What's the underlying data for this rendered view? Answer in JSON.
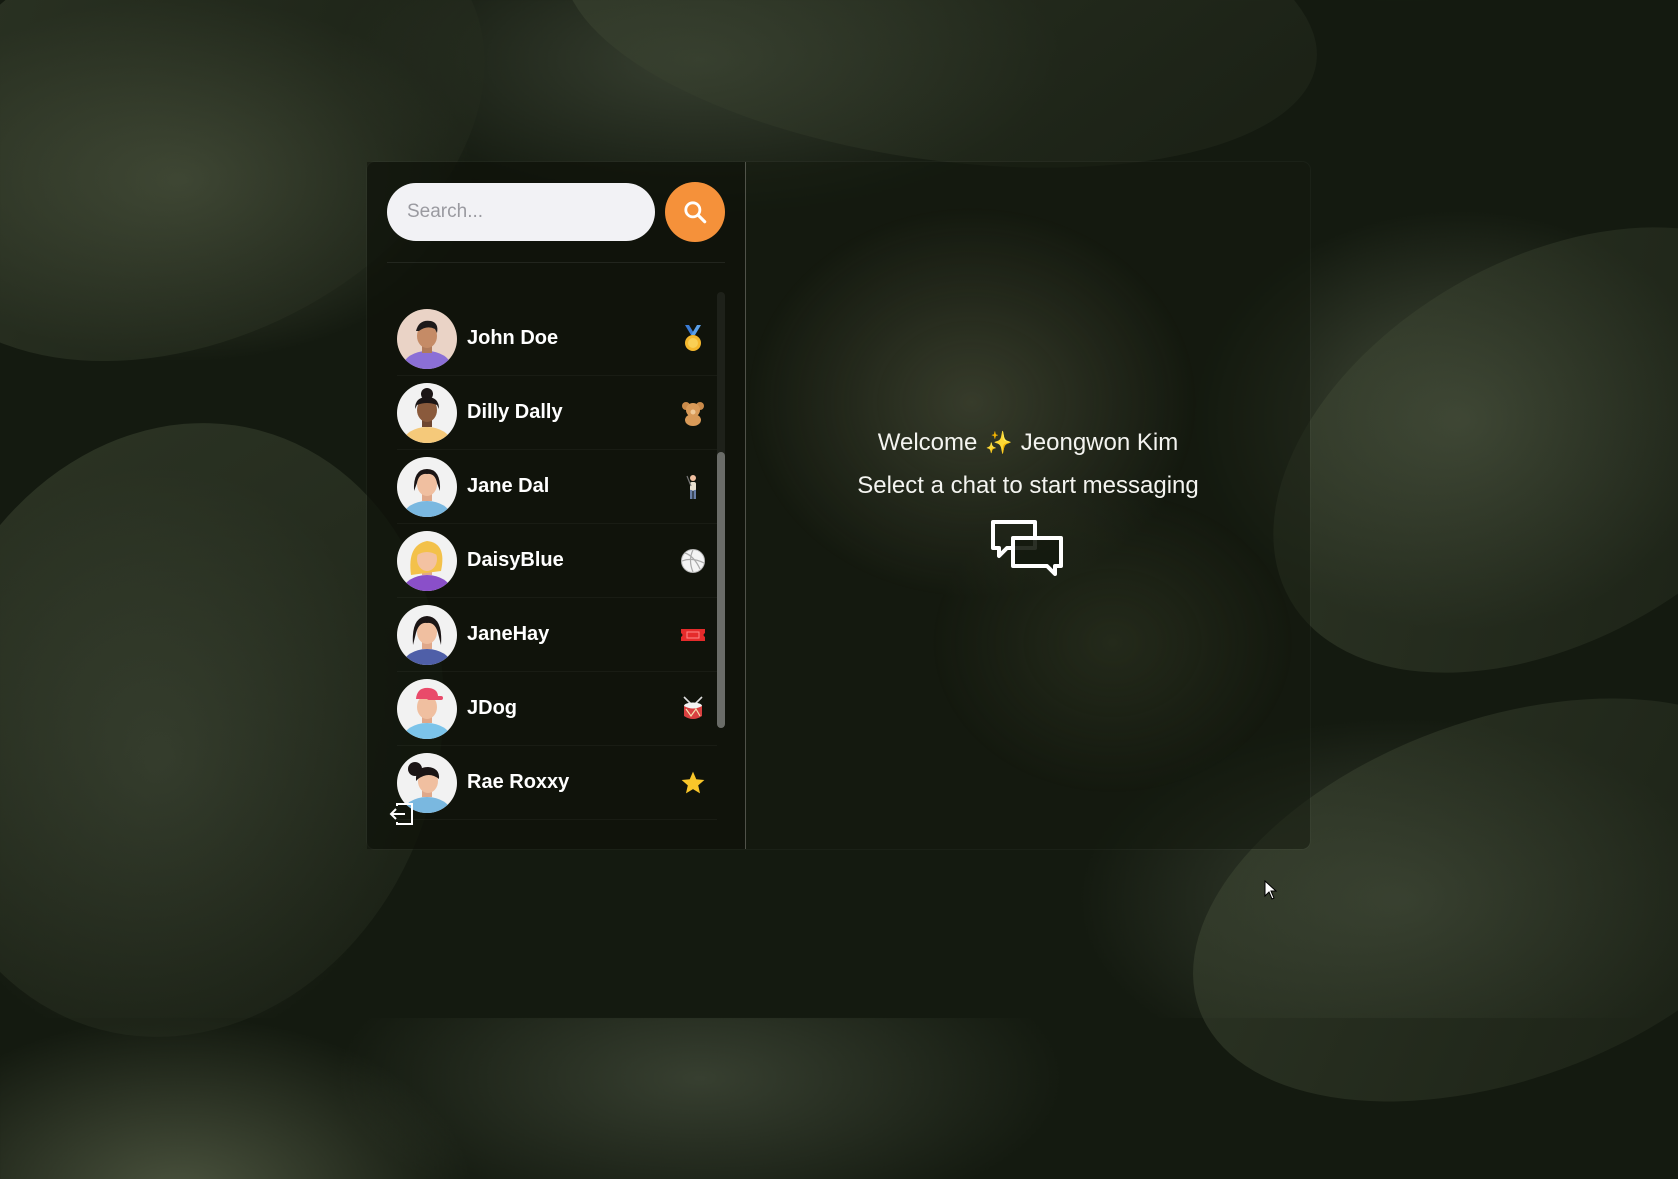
{
  "search": {
    "placeholder": "Search..."
  },
  "chats": [
    {
      "name": "John Doe",
      "emoji": "medal-icon",
      "avatar_color": "#e8c9b8",
      "shirt": "#8b6fd6"
    },
    {
      "name": "Dilly Dally",
      "emoji": "teddy-bear-icon",
      "avatar_color": "#f2f2f2",
      "shirt": "#f5c97a"
    },
    {
      "name": "Jane Dal",
      "emoji": "golfer-icon",
      "avatar_color": "#f2f2f2",
      "shirt": "#7ab8e0"
    },
    {
      "name": "DaisyBlue",
      "emoji": "volleyball-icon",
      "avatar_color": "#f2f2f2",
      "shirt": "#8a4fc9"
    },
    {
      "name": "JaneHay",
      "emoji": "ticket-icon",
      "avatar_color": "#f2f2f2",
      "shirt": "#4f5fa8"
    },
    {
      "name": "JDog",
      "emoji": "drum-icon",
      "avatar_color": "#f2f2f2",
      "shirt": "#7cc4ea"
    },
    {
      "name": "Rae Roxxy",
      "emoji": "star-icon",
      "avatar_color": "#f2f2f2",
      "shirt": "#7ab8e0"
    }
  ],
  "welcome": {
    "greeting": "Welcome",
    "sparkle": "✨",
    "user_name": "Jeongwon Kim",
    "subtitle": "Select a chat to start messaging"
  },
  "colors": {
    "accent": "#f5913a",
    "text": "#ffffff"
  }
}
